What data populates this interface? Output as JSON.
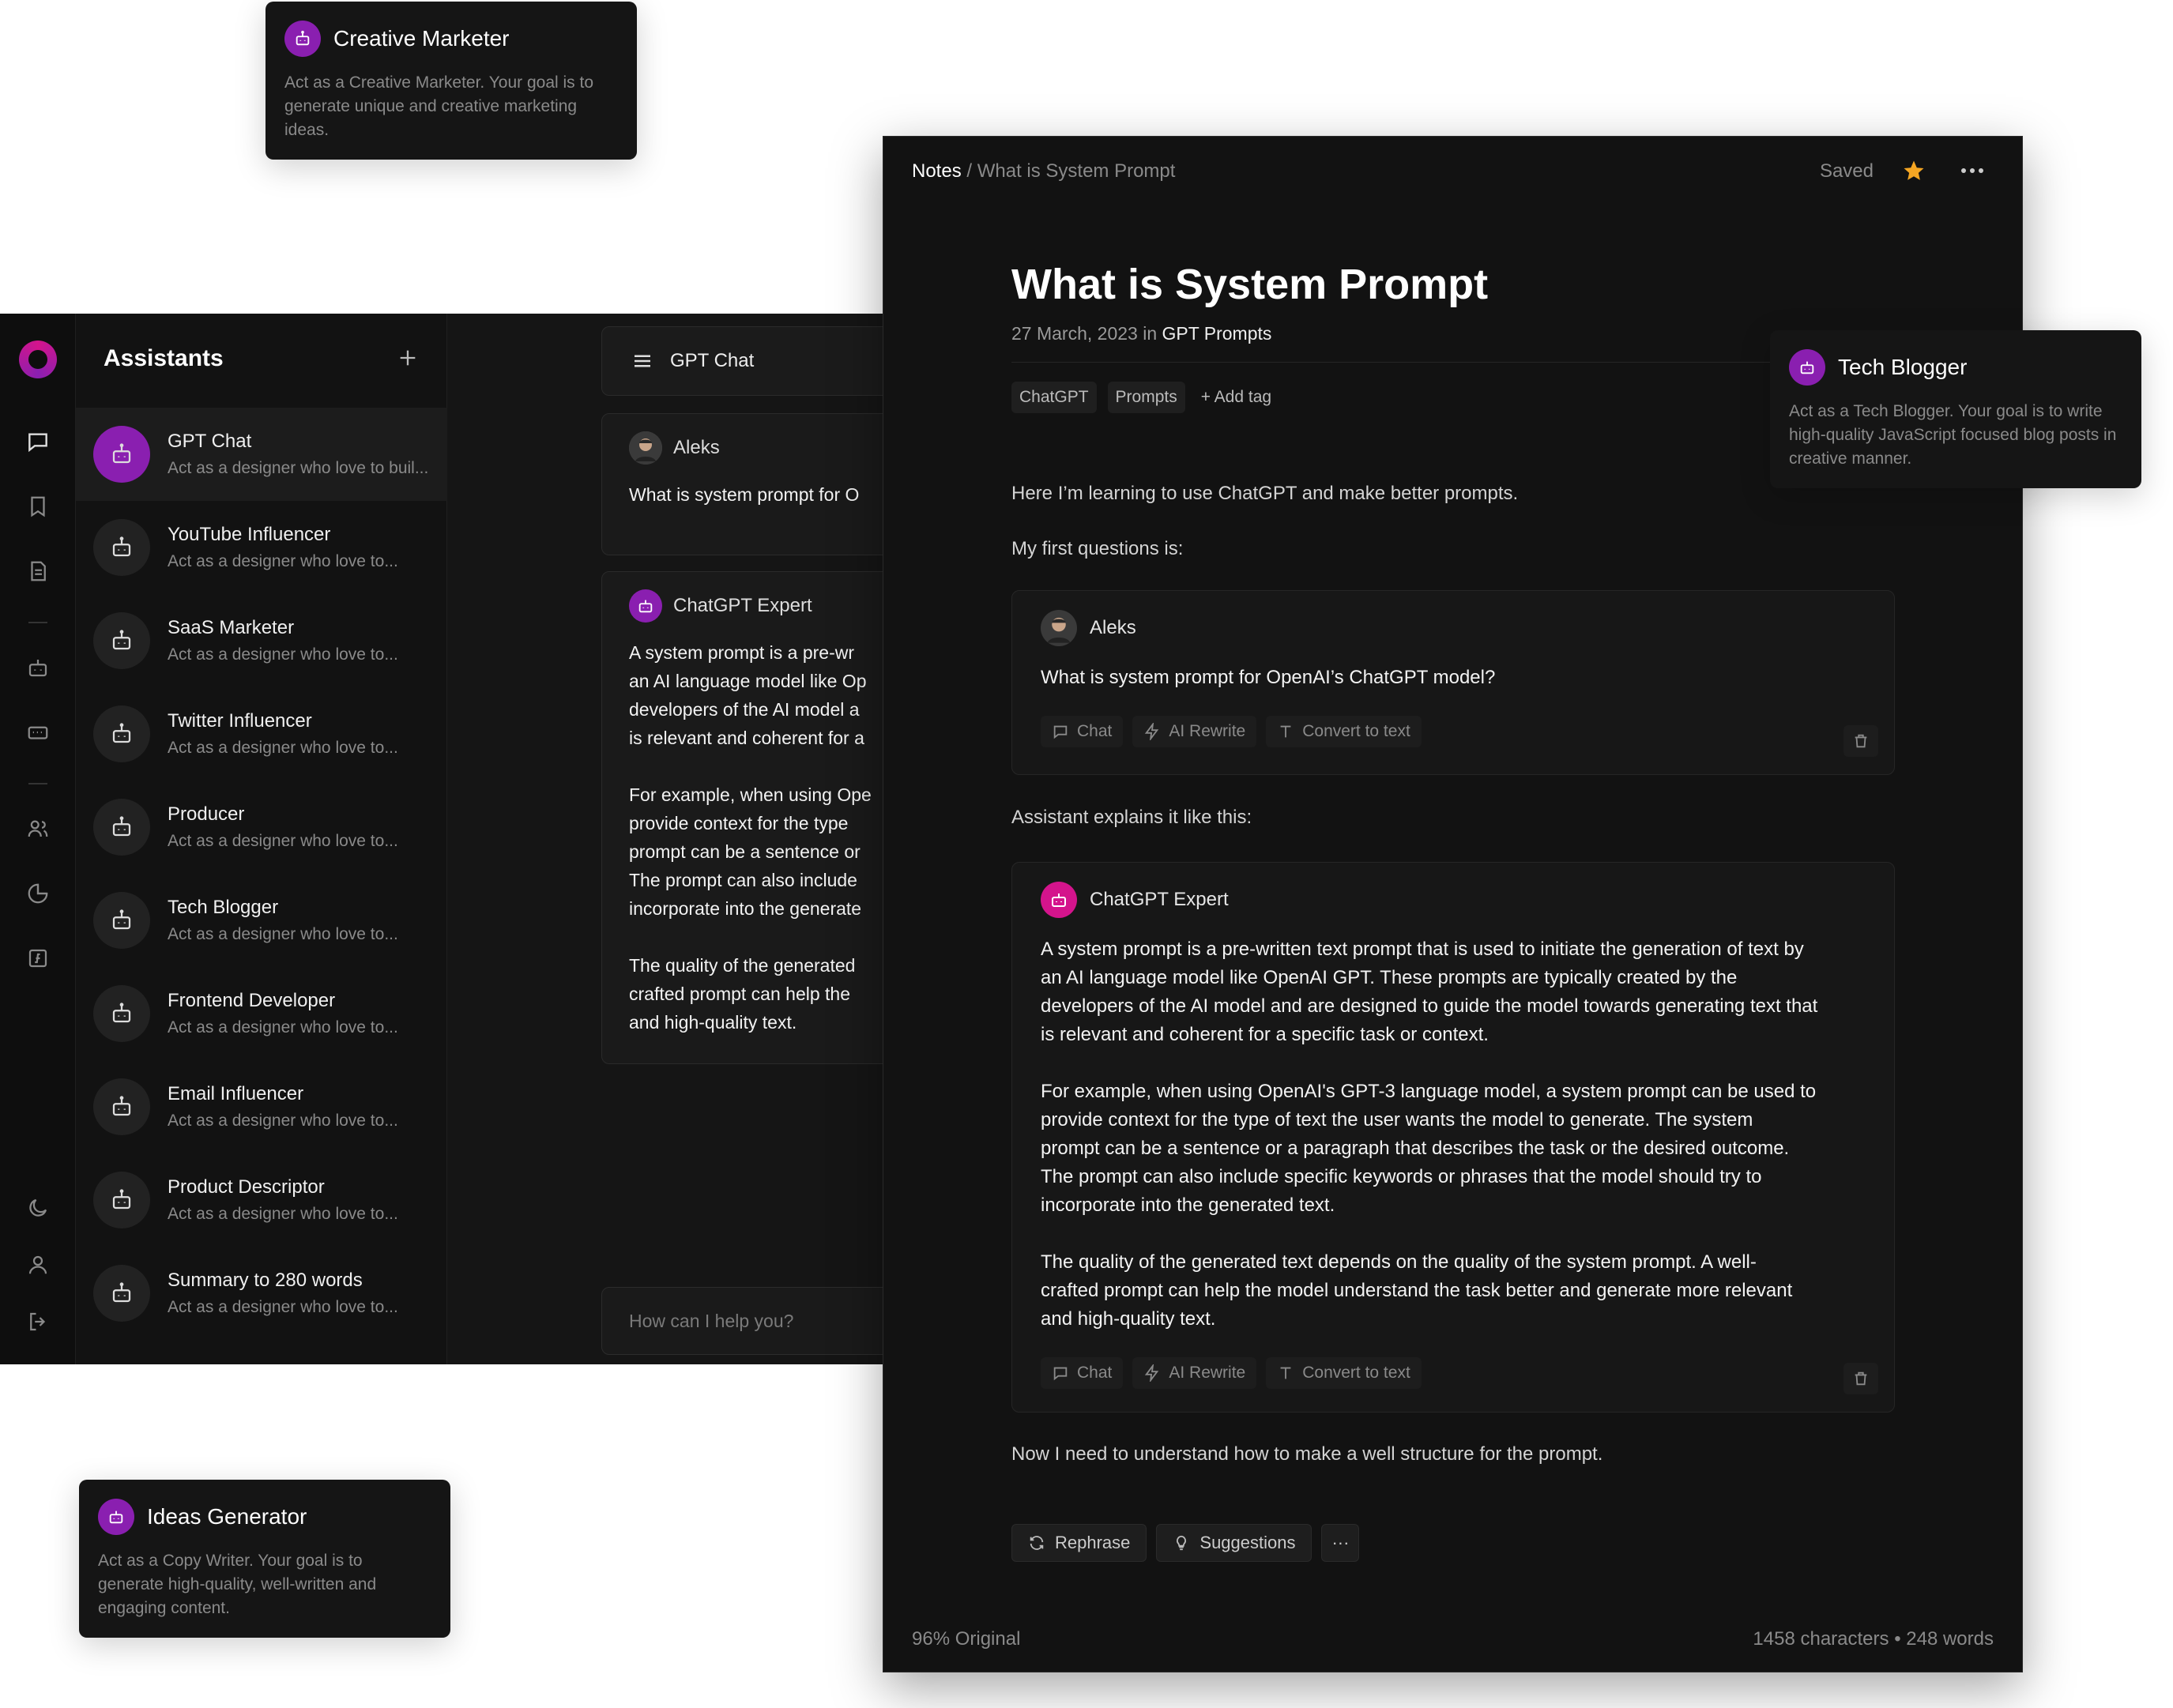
{
  "colors": {
    "accent_purple": "#8a1fb0",
    "accent_pink": "#d4148c",
    "star": "#f5a623",
    "bg_dark": "#121212"
  },
  "floating_cards": {
    "creative_marketer": {
      "title": "Creative Marketer",
      "desc": "Act as a Creative Marketer. Your goal is to generate unique and creative marketing ideas."
    },
    "tech_blogger": {
      "title": "Tech Blogger",
      "desc": "Act as a Tech Blogger. Your goal is to write high-quality JavaScript focused blog posts in creative manner."
    },
    "ideas_generator": {
      "title": "Ideas Generator",
      "desc": "Act as a Copy Writer. Your goal is to generate high-quality, well-written and engaging content."
    }
  },
  "sidebar": {
    "icons": [
      "chat-icon",
      "bookmark-icon",
      "document-icon",
      "robot-icon",
      "keyboard-icon",
      "users-icon",
      "pie-chart-icon",
      "function-icon",
      "moon-icon",
      "user-icon",
      "logout-icon"
    ]
  },
  "assistants": {
    "title": "Assistants",
    "items": [
      {
        "name": "GPT Chat",
        "desc": "Act as a designer who love to buil..."
      },
      {
        "name": "YouTube Influencer",
        "desc": "Act as a designer who love to..."
      },
      {
        "name": "SaaS Marketer",
        "desc": "Act as a designer who love to..."
      },
      {
        "name": "Twitter Influencer",
        "desc": "Act as a designer who love to..."
      },
      {
        "name": "Producer",
        "desc": "Act as a designer who love to..."
      },
      {
        "name": "Tech Blogger",
        "desc": "Act as a designer who love to..."
      },
      {
        "name": "Frontend Developer",
        "desc": "Act as a designer who love to..."
      },
      {
        "name": "Email Influencer",
        "desc": "Act as a designer who love to..."
      },
      {
        "name": "Product Descriptor",
        "desc": "Act as a designer who love to..."
      },
      {
        "name": "Summary to 280 words",
        "desc": "Act as a designer who love to..."
      }
    ]
  },
  "chat": {
    "header": "GPT Chat",
    "user_name": "Aleks",
    "user_msg": "What is system prompt for O",
    "bot_name": "ChatGPT Expert",
    "bot_msg": "A system prompt is a pre-wr\nan AI language model like Op\ndevelopers of the AI model a\nis relevant and coherent for a\n\nFor example, when using Ope\nprovide context for the type\nprompt can be a sentence or\nThe prompt can also include\nincorporate into the generate\n\nThe quality of the generated\ncrafted prompt can help the\nand high-quality text.",
    "input_placeholder": "How can I help you?"
  },
  "note": {
    "breadcrumb_root": "Notes",
    "breadcrumb_sep": " / ",
    "breadcrumb_current": "What is System Prompt",
    "status": "Saved",
    "title": "What is System Prompt",
    "date": "27 March, 2023 in ",
    "category": "GPT Prompts",
    "tags": [
      "ChatGPT",
      "Prompts"
    ],
    "add_tag": "+ Add tag",
    "para1": "Here I’m learning to use ChatGPT and make better prompts.",
    "para2": "My first questions is:",
    "q_name": "Aleks",
    "q_text": "What is system prompt for OpenAI’s ChatGPT model?",
    "para3": "Assistant explains it like this:",
    "a_name": "ChatGPT Expert",
    "a_text": "A system prompt is a pre-written text prompt that is used to initiate the generation of text by\nan AI language model like OpenAI GPT. These prompts are typically created by the\ndevelopers of the AI model and are designed to guide the model towards generating text that\nis relevant and coherent for a specific task or context.\n\nFor example, when using OpenAI's GPT-3 language model, a system prompt can be used to\nprovide context for the type of text the user wants the model to generate. The system\nprompt can be a sentence or a paragraph that describes the task or the desired outcome.\nThe prompt can also include specific keywords or phrases that the model should try to\nincorporate into the generated text.\n\nThe quality of the generated text depends on the quality of the system prompt. A well-\ncrafted prompt can help the model understand the task better and generate more relevant\nand high-quality text.",
    "para4": "Now I need to understand how to make a well structure for the prompt.",
    "actions": {
      "chat": "Chat",
      "rewrite": "AI Rewrite",
      "convert": "Convert to text"
    },
    "bottom": {
      "rephrase": "Rephrase",
      "suggestions": "Suggestions",
      "more": "···"
    },
    "footer_left": "96% Original",
    "footer_right": "1458 characters • 248 words"
  }
}
